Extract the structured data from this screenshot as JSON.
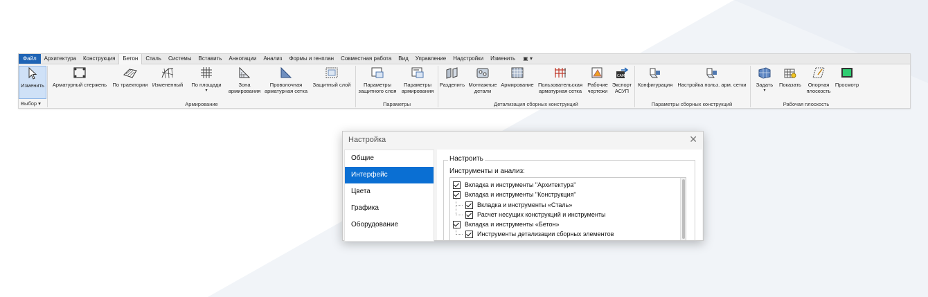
{
  "ribbon": {
    "tabs": [
      "Файл",
      "Архитектура",
      "Конструкция",
      "Бетон",
      "Сталь",
      "Системы",
      "Вставить",
      "Аннотации",
      "Анализ",
      "Формы и генплан",
      "Совместная работа",
      "Вид",
      "Управление",
      "Надстройки",
      "Изменить",
      "▣ ▾"
    ],
    "active_tab": "Бетон",
    "tools": {
      "modify": "Изменить",
      "rebar": "Арматурный стержень",
      "path": "По траектории",
      "changed": "Измененный",
      "area": "По площади",
      "zone1": "Зона",
      "zone2": "армирования",
      "wire1": "Проволочная",
      "wire2": "арматурная сетка",
      "cover": "Защитный слой",
      "pcover1": "Параметры",
      "pcover2": "защитного слоя",
      "preinf1": "Параметры",
      "preinf2": "армирования",
      "split": "Разделить",
      "mount1": "Монтажные",
      "mount2": "детали",
      "reinf": "Армирование",
      "user1": "Пользовательская",
      "user2": "арматурная сетка",
      "work1": "Рабочие",
      "work2": "чертежи",
      "export1": "Экспорт",
      "export2": "АСУП",
      "config": "Конфигурация",
      "usermesh": "Настройка польз. арм. сетки",
      "set": "Задать",
      "show": "Показать",
      "ref1": "Опорная",
      "ref2": "плоскость",
      "view": "Просмотр"
    },
    "groups": {
      "select": "Выбор ▾",
      "reinforcement": "Армирование",
      "params": "Параметры",
      "detailing": "Детализация сборных конструкций",
      "precast_params": "Параметры сборных конструкций",
      "workplane": "Рабочая плоскость"
    }
  },
  "dialog": {
    "title": "Настройка",
    "close": "✕",
    "nav": [
      "Общие",
      "Интерфейс",
      "Цвета",
      "Графика",
      "Оборудование"
    ],
    "active_nav": "Интерфейс",
    "legend": "Настроить",
    "subhead": "Инструменты и анализ:",
    "items": [
      {
        "label": "Вкладка и инструменты \"Архитектура\"",
        "checked": true,
        "level": 0
      },
      {
        "label": "Вкладка и инструменты \"Конструкция\"",
        "checked": true,
        "level": 0
      },
      {
        "label": "Вкладка и инструменты «Сталь»",
        "checked": true,
        "level": 1
      },
      {
        "label": "Расчет несущих конструкций и инструменты",
        "checked": true,
        "level": 1
      },
      {
        "label": "Вкладка и инструменты «Бетон»",
        "checked": true,
        "level": 0
      },
      {
        "label": "Инструменты детализации сборных элементов",
        "checked": true,
        "level": 1
      }
    ]
  },
  "colors": {
    "accent": "#0a6fd3",
    "file_tab": "#1f64b5"
  }
}
